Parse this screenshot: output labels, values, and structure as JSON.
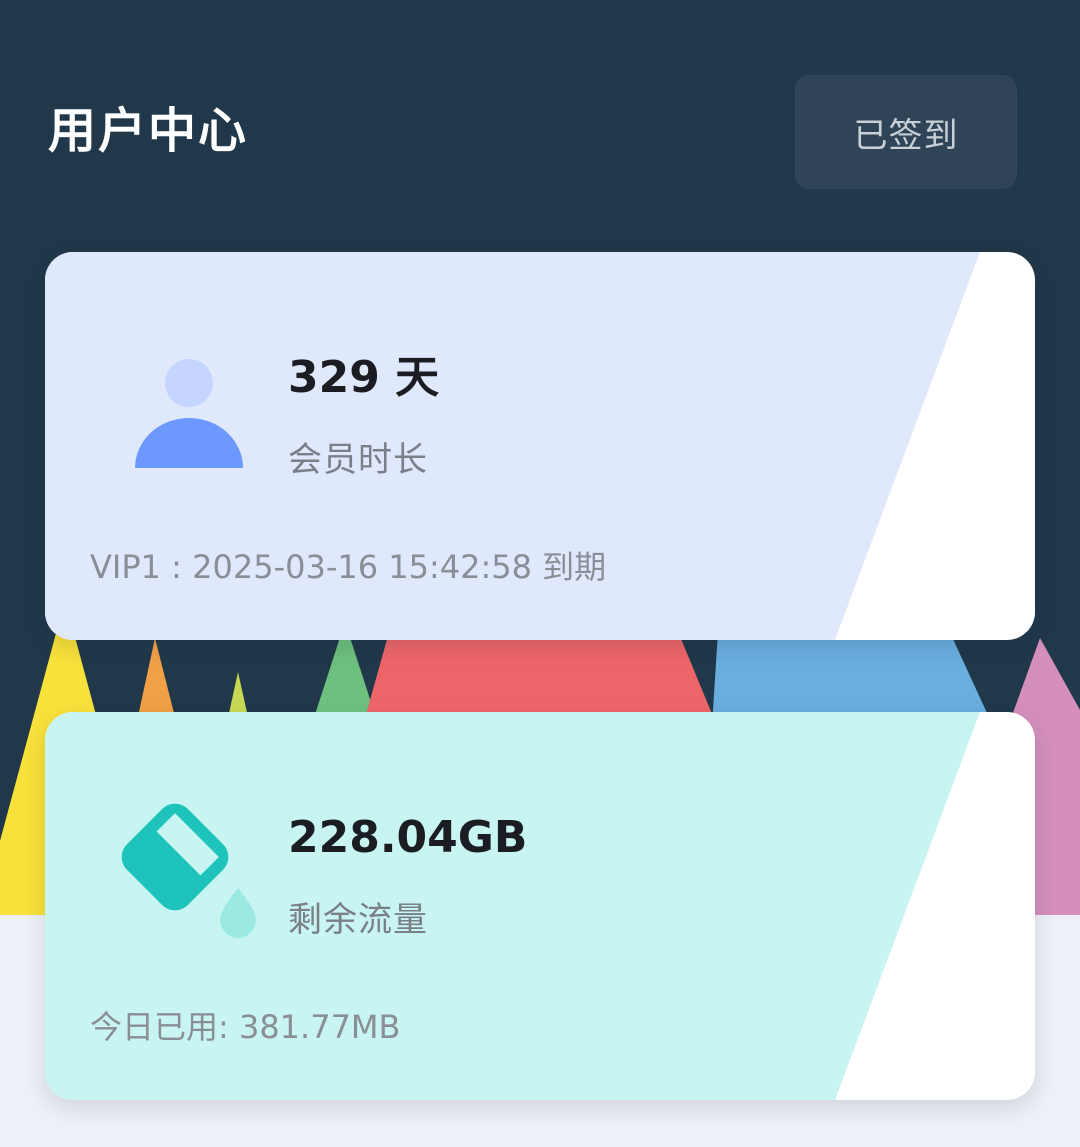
{
  "header": {
    "title": "用户中心",
    "checkin_button_label": "已签到"
  },
  "member_card": {
    "value": "329 天",
    "label": "会员时长",
    "footer": "VIP1 : 2025-03-16 15:42:58 到期",
    "icon": "user-icon"
  },
  "traffic_card": {
    "value": "228.04GB",
    "label": "剩余流量",
    "footer": "今日已用:  381.77MB",
    "icon": "paint-bucket-icon"
  },
  "colors": {
    "header_background": "#20384a",
    "checkin_button_background": "#2f4456",
    "member_card_tint": "#e0e8fb",
    "traffic_card_tint": "#c8f5f2",
    "member_icon": "#6c98ff",
    "traffic_icon": "#1ec4bc"
  }
}
